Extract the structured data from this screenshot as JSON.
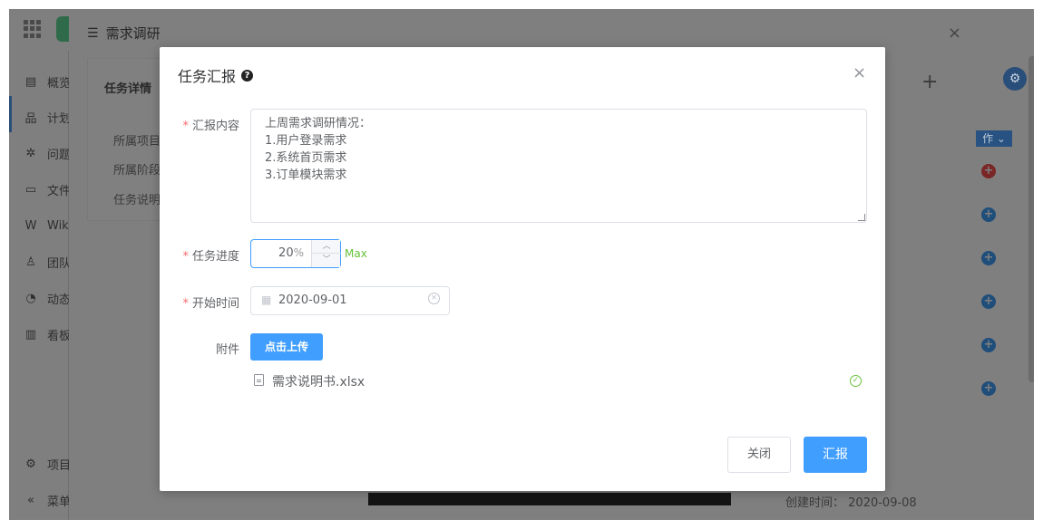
{
  "subwindow": {
    "title": "需求调研"
  },
  "sidebar": {
    "items": [
      {
        "label": "概览",
        "icon": "overview-icon",
        "glyph": "▤"
      },
      {
        "label": "计划",
        "icon": "sitemap-icon",
        "glyph": "品"
      },
      {
        "label": "问题",
        "icon": "bug-icon",
        "glyph": "✲"
      },
      {
        "label": "文件",
        "icon": "folder-icon",
        "glyph": "▭"
      },
      {
        "label": "Wiki",
        "icon": "wiki-icon",
        "glyph": "W"
      },
      {
        "label": "团队",
        "icon": "team-icon",
        "glyph": "♙"
      },
      {
        "label": "动态",
        "icon": "activity-icon",
        "glyph": "◔"
      },
      {
        "label": "看板",
        "icon": "chart-icon",
        "glyph": "▥"
      }
    ],
    "footer": [
      {
        "label": "项目",
        "glyph": "⚙"
      },
      {
        "label": "菜单",
        "glyph": "«"
      }
    ]
  },
  "background": {
    "panel_title": "任务详情",
    "rows": [
      "所属项目",
      "所属阶段",
      "任务说明"
    ],
    "op_button": "作 ⌄",
    "bottom_date_label": "创建时间：",
    "bottom_date": "2020-09-08"
  },
  "modal": {
    "title": "任务汇报",
    "close_glyph": "×",
    "fields": {
      "content_label": "汇报内容",
      "content_value": "上周需求调研情况：\n1.用户登录需求\n2.系统首页需求\n3.订单模块需求",
      "progress_label": "任务进度",
      "progress_value": "20",
      "progress_unit": "%",
      "progress_max": "Max",
      "start_label": "开始时间",
      "start_value": "2020-09-01",
      "attachment_label": "附件",
      "upload_button": "点击上传",
      "file_name": "需求说明书.xlsx"
    },
    "buttons": {
      "close": "关闭",
      "submit": "汇报"
    }
  },
  "colors": {
    "primary": "#409eff",
    "required": "#f56c6c",
    "success": "#67c23a"
  }
}
